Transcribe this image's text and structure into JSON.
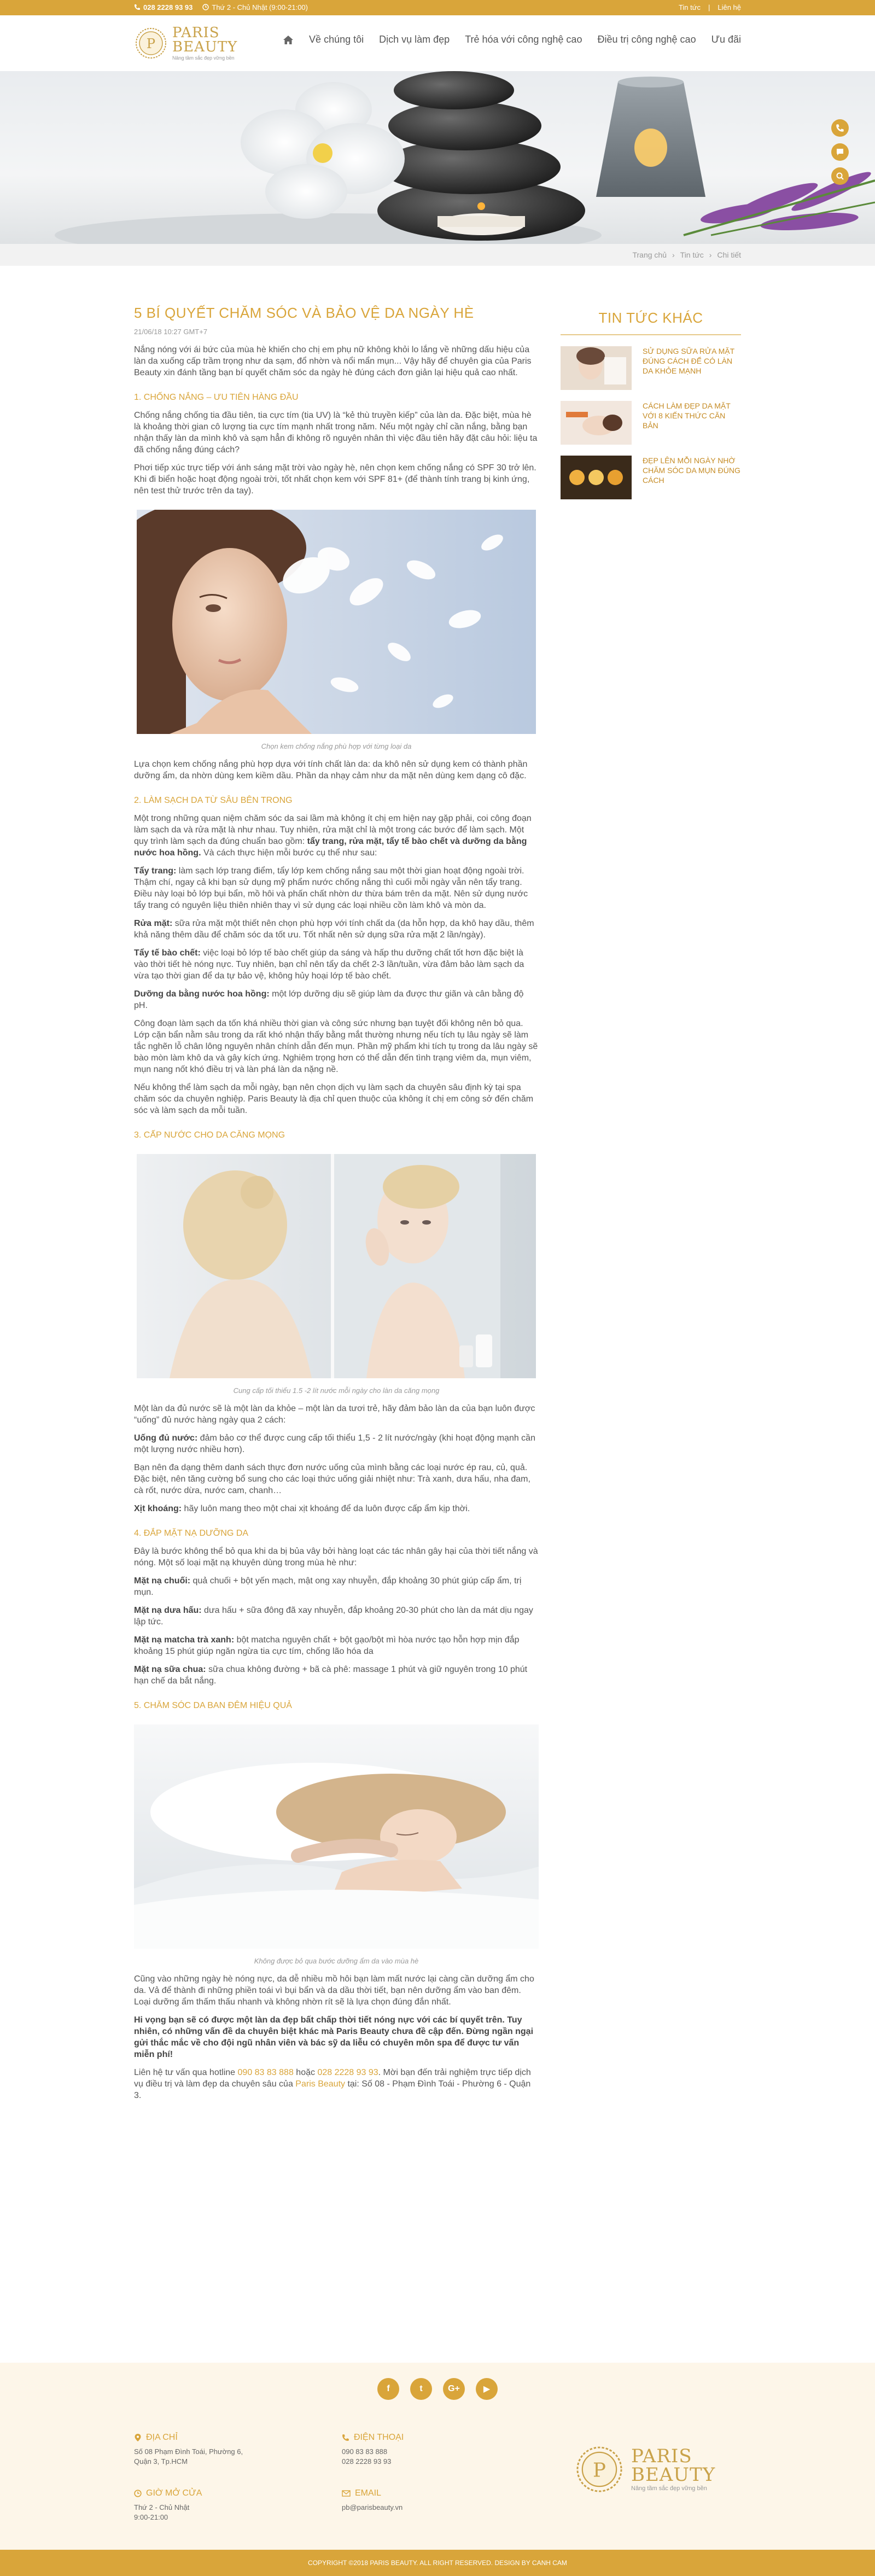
{
  "topbar": {
    "phone": "028 2228 93 93",
    "hours": "Thứ 2 - Chủ Nhật (9:00-21:00)",
    "links": [
      "Tin tức",
      "Liên hệ"
    ]
  },
  "logo": {
    "line1": "PARIS",
    "line2": "BEAUTY",
    "tagline": "Nâng tầm sắc đẹp vững bền"
  },
  "nav": {
    "items": [
      "Về chúng tôi",
      "Dịch vụ làm đẹp",
      "Trẻ hóa với công nghệ cao",
      "Điều trị công nghệ cao",
      "Ưu đãi"
    ]
  },
  "breadcrumb": {
    "items": [
      "Trang chủ",
      "Tin tức",
      "Chi tiết"
    ]
  },
  "article": {
    "title": "5 BÍ QUYẾT CHĂM SÓC VÀ BẢO VỆ DA NGÀY HÈ",
    "date": "21/06/18 10:27 GMT+7",
    "intro": "Nắng nóng với ái bức của mùa hè khiến cho chị em phụ nữ không khỏi lo lắng về những dấu hiệu của làn da xuống cấp trầm trọng như da sạm, đổ nhờn và nổi mẩn mụn... Vậy hãy để chuyên gia của Paris Beauty xin đánh tầng bạn bí quyết chăm sóc da ngày hè đúng cách đơn giản lại hiệu quả cao nhất.",
    "s1": {
      "heading": "1. CHỐNG NẮNG – ƯU TIÊN HÀNG ĐẦU",
      "p1": "Chống nắng chống tia đầu tiên, tia cực tím (tia UV) là “kẻ thù truyền kiếp” của làn da. Đặc biệt, mùa hè là khoảng thời gian cô lượng tia cực tím mạnh nhất trong năm. Nếu một ngày chỉ cần nắng, bằng bạn nhận thấy làn da mình khô và sạm hẳn đi không rõ nguyên nhân thì việc đầu tiên hãy đặt câu hỏi: liệu ta đã chống nắng đúng cách?",
      "p2": "Phơi tiếp xúc trực tiếp với ánh sáng mặt trời vào ngày hè, nên chọn kem chống nắng có SPF 30 trở lên. Khi đi biển hoặc hoạt động ngoài trời, tốt nhất chọn kem với SPF 81+ (để thành tính trang bị kinh ứng, nên test thử trước trên da tay).",
      "caption": "Chọn kem chống nắng phù hợp với từng loại da",
      "p3": "Lựa chọn kem chống nắng phù hợp dựa với tính chất làn da: da khô nên sử dụng kem có thành phần dưỡng ẩm, da nhờn dùng kem kiềm dầu. Phần da nhạy cảm như da mặt nên dùng kem dạng cô đặc."
    },
    "s2": {
      "heading": "2. LÀM SẠCH DA TỪ SÂU BÊN TRONG",
      "p1_a": "Một trong những quan niệm chăm sóc da sai lầm mà không ít chị em hiện nay gặp phải, coi công đoạn làm sạch da và rửa mặt là như nhau. Tuy nhiên, rửa mặt chỉ là một trong các bước để làm sạch. Một quy trình làm sạch da đúng chuẩn bao gồm: ",
      "p1_b": "tẩy trang, rửa mặt, tẩy tế bào chết và dưỡng da bằng nước hoa hồng.",
      "p1_c": " Và cách thực hiện mỗi bước cụ thể như sau:",
      "p2_b": "Tẩy trang:",
      "p2": " làm sạch lớp trang điểm, tẩy lớp kem chống nắng sau một thời gian hoạt động ngoài trời. Thậm chí, ngay cả khi bạn sử dụng mỹ phẩm nước chống nắng thì cuối mỗi ngày vẫn nên tẩy trang. Điều này loại bỏ lớp bụi bẩn, mồ hôi và phấn chất nhờn dư thừa bám trên da mặt. Nên sử dụng nước tẩy trang có nguyên liệu thiên nhiên thay vì sử dụng các loại nhiều cồn làm khô và mòn da.",
      "p3_b": "Rửa mặt:",
      "p3": " sữa rửa mặt một thiết nên chọn phù hợp với tính chất da (da hỗn hợp, da khô hay dầu, thêm khả năng thêm dầu để chăm sóc da tốt ưu. Tốt nhất nên sử dụng sữa rửa mặt 2 lần/ngày).",
      "p4_b": "Tẩy tế bào chết:",
      "p4": " việc loại bỏ lớp tế bào chết giúp da sáng và hấp thu dưỡng chất tốt hơn đặc biệt là vào thời tiết hè nóng nực. Tuy nhiên, bạn chỉ nên tẩy da chết 2-3 lần/tuần, vừa đảm bảo làm sạch da vừa tạo thời gian để da tự bảo vệ, không hủy hoại lớp tế bào chết.",
      "p5_b": "Dưỡng da bằng nước hoa hồng:",
      "p5": " một lớp dưỡng dịu sẽ giúp làm da được thư giãn và cân bằng độ pH.",
      "p6": "Công đoạn làm sạch da tốn khá nhiều thời gian và công sức nhưng bạn tuyệt đối không nên bỏ qua. Lớp cặn bẩn nằm sâu trong da rất khó nhận thấy bằng mắt thường nhưng nếu tích tụ lâu ngày sẽ làm tắc nghẽn lỗ chân lông nguyên nhân chính dẫn đến mụn. Phần mỹ phẩm khi tích tụ trong da lâu ngày sẽ bào mòn làm khô da và gây kích ứng. Nghiêm trọng hơn có thể dẫn đến tình trạng viêm da, mụn viêm, mụn nang nốt khó điều trị và làn phá làn da nặng nề.",
      "p7": "Nếu không thể làm sạch da mỗi ngày, bạn nên chọn dịch vụ làm sạch da chuyên sâu định kỳ tại spa chăm sóc da chuyên nghiệp. Paris Beauty là địa chỉ quen thuộc của không ít chị em công sở đến chăm sóc và làm sạch da mỗi tuần."
    },
    "s3": {
      "heading": "3. CẤP NƯỚC CHO DA CĂNG MỌNG",
      "caption": "Cung cấp tối thiểu 1.5 -2 lít nước mỗi ngày cho làn da căng mọng",
      "p1": "Một làn da đủ nước sẽ là một làn da khỏe – một làn da tươi trẻ, hãy đảm bảo làn da của bạn luôn được “uống” đủ nước hàng ngày qua 2 cách:",
      "p2_b": "Uống đủ nước:",
      "p2": " đảm bảo cơ thể được cung cấp tối thiểu 1,5 - 2 lít nước/ngày (khi hoạt động mạnh cần một lượng nước nhiều hơn).",
      "p3": "Bạn nên đa dạng thêm danh sách thực đơn nước uống của mình bằng các loại nước ép rau, củ, quả. Đặc biệt, nên tăng cường bổ sung cho các loại thức uống giải nhiệt như: Trà xanh, dưa hấu, nha đam, cà rốt, nước dừa, nước cam, chanh…",
      "p4_b": "Xịt khoáng:",
      "p4": " hãy luôn mang theo một chai xịt khoáng để da luôn được cấp ẩm kịp thời."
    },
    "s4": {
      "heading": "4. ĐẮP MẶT NẠ DƯỠNG DA",
      "p1": "Đây là bước không thể bỏ qua khi da bị bủa vây bởi hàng loạt các tác nhân gây hại của thời tiết nắng và nóng. Một số loại mặt nạ khuyên dùng trong mùa hè như:",
      "p2_b": "Mặt nạ chuối:",
      "p2": " quả chuối + bột yến mạch, mật ong xay nhuyễn, đắp khoảng 30 phút giúp cấp ẩm, trị mụn.",
      "p3_b": "Mặt nạ dưa hấu:",
      "p3": " dưa hấu + sữa đông đã xay nhuyễn, đắp khoảng 20-30 phút cho làn da mát dịu ngay lập tức.",
      "p4_b": "Mặt nạ matcha trà xanh:",
      "p4": " bột matcha nguyên chất + bột gạo/bột mì hòa nước tạo hỗn hợp mịn đắp khoảng 15 phút giúp ngăn ngừa tia cực tím, chống lão hóa da",
      "p5_b": "Mặt nạ sữa chua:",
      "p5": " sữa chua không đường + bã cà phê: massage 1 phút và giữ nguyên trong 10 phút hạn chế da bắt nắng."
    },
    "s5": {
      "heading": "5. CHĂM SÓC DA BAN ĐÊM HIỆU QUẢ",
      "caption": "Không được bỏ qua bước dưỡng ẩm da vào mùa hè",
      "p1": "Cũng vào những ngày hè nóng nực, da dễ nhiều mồ hôi bạn làm mất nước lại càng cần dưỡng ẩm cho da. Vả để thành đi những phiền toái vì bụi bẩn và da dầu thời tiết, bạn nên dưỡng ẩm vào ban đêm. Loại dưỡng ẩm thấm thấu nhanh và không nhờn rít sẽ là lựa chọn đúng đắn nhất.",
      "p2_b": "Hi vọng bạn sẽ có được một làn da đẹp bất chấp thời tiết nóng nực với các bí quyết trên. Tuy nhiên, có những vấn đề da chuyên biệt khác mà Paris Beauty chưa đề cập đến. Đừng ngần ngại gửi thắc mắc về cho đội ngũ nhân viên và bác sỹ da liễu có chuyên môn spa để được tư vấn miễn phí!",
      "p3_a": "Liên hệ tư vấn qua hotline ",
      "p3_h1": "090 83 83 888",
      "p3_m": " hoặc ",
      "p3_h2": "028 2228 93 93",
      "p3_c": ". Mời bạn đến trải nghiệm trực tiếp dịch vụ điều trị và làm đẹp da chuyên sâu của ",
      "p3_brand": "Paris Beauty",
      "p3_d": " tại: Số 08 - Phạm Đình Toái - Phường 6 - Quận 3."
    }
  },
  "sidebar": {
    "title": "TIN TỨC KHÁC",
    "items": [
      "SỬ DỤNG SỮA RỬA MẶT ĐÚNG CÁCH ĐỂ CÓ LÀN DA KHỎE MẠNH",
      "CÁCH LÀM ĐẸP DA MẶT VỚI 8 KIẾN THỨC CĂN BẢN",
      "ĐẸP LÊN MỖI NGÀY NHỜ CHĂM SÓC DA MỤN ĐÚNG CÁCH"
    ]
  },
  "footer": {
    "social": [
      "f",
      "t",
      "G+",
      "▶"
    ],
    "address_h": "ĐỊA CHỈ",
    "address": "Số 08 Phạm Đình Toái, Phường 6, Quận 3, Tp.HCM",
    "phone_h": "ĐIỆN THOẠI",
    "phone1": "090 83 83 888",
    "phone2": "028 2228 93 93",
    "hours_h": "GIỜ MỞ CỬA",
    "hours1": "Thứ 2 - Chủ Nhật",
    "hours2": "9:00-21:00",
    "email_h": "EMAIL",
    "email": "pb@parisbeauty.vn",
    "copyright": "COPYRIGHT ©2018 PARIS BEAUTY. ALL RIGHT RESERVED. DESIGN BY CANH CAM"
  },
  "colors": {
    "accent": "#d9a53a",
    "footer_bg": "#fdf6e9"
  }
}
